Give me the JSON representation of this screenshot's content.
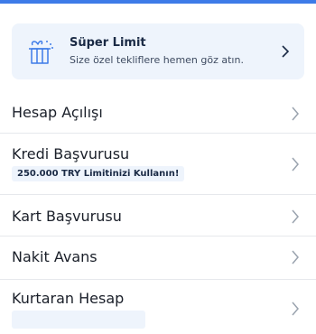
{
  "promo": {
    "title": "Süper Limit",
    "subtitle": "Size özel tekliflere hemen göz atın.",
    "icon": "gift-icon"
  },
  "menu": [
    {
      "label": "Hesap Açılışı"
    },
    {
      "label": "Kredi Başvurusu",
      "badge": "250.000 TRY Limitinizi Kullanın!"
    },
    {
      "label": "Kart Başvurusu"
    },
    {
      "label": "Nakit Avans"
    },
    {
      "label": "Kurtaran Hesap",
      "badge": ""
    }
  ],
  "colors": {
    "accent": "#3d7be8",
    "promo_bg": "#eef4fc",
    "chevron": "#9aa3ae",
    "text": "#1a1f29"
  }
}
